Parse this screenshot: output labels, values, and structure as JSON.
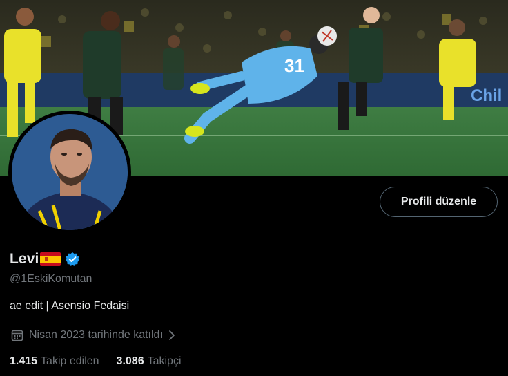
{
  "profile": {
    "display_name": "Levi",
    "flag_emoji_icon": "spain-flag-icon",
    "verified_icon": "verified-badge-icon",
    "handle": "@1EskiKomutan",
    "bio": "ae edit | Asensio Fedaisi",
    "joined": "Nisan 2023 tarihinde katıldı",
    "edit_button_label": "Profili düzenle"
  },
  "stats": [
    {
      "count": "1.415",
      "label": "Takip edilen"
    },
    {
      "count": "3.086",
      "label": "Takipçi"
    }
  ],
  "banner": {
    "jersey_number": "31",
    "ad_board_text": "Chil"
  },
  "colors": {
    "background": "#000000",
    "primary_text": "#e7e9ea",
    "secondary_text": "#71767b",
    "button_border": "#536471",
    "verified_blue": "#1d9bf0"
  }
}
